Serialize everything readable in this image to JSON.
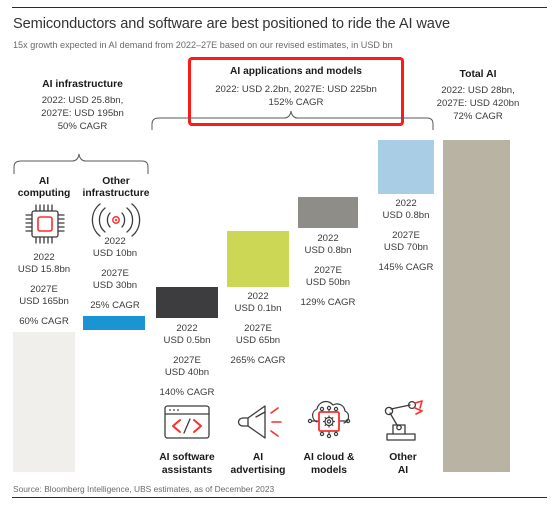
{
  "header": {
    "title": "Semiconductors and software are best positioned to ride the AI wave",
    "subtitle": "15x growth expected in AI demand from 2022–27E based on our revised estimates, in USD bn"
  },
  "footer": {
    "source": "Source: Bloomberg Intelligence, UBS estimates, as of December 2023"
  },
  "groups": {
    "ai_infrastructure": {
      "title": "AI infrastructure",
      "line1": "2022: USD 25.8bn,",
      "line2": "2027E: USD 195bn",
      "line3": "50% CAGR"
    },
    "ai_applications": {
      "title": "AI applications and models",
      "line1": "2022: USD 2.2bn, 2027E: USD 225bn",
      "line2": "152% CAGR",
      "highlight_color": "#ff1a1a"
    },
    "total_ai": {
      "title": "Total AI",
      "line1": "2022: USD 28bn,",
      "line2": "2027E: USD 420bn",
      "line3": "72% CAGR"
    }
  },
  "columns": [
    {
      "id": "ai-computing",
      "heading_line1": "AI",
      "heading_line2": "computing",
      "icon": "microchip-icon",
      "v2022_label": "2022",
      "v2022_value": "USD 15.8bn",
      "v2027_label": "2027E",
      "v2027_value": "USD 165bn",
      "cagr": "60% CAGR",
      "bar_color": "#f0efec"
    },
    {
      "id": "other-infrastructure",
      "heading_line1": "Other",
      "heading_line2": "infrastructure",
      "icon": "wireless-signal-icon",
      "v2022_label": "2022",
      "v2022_value": "USD 10bn",
      "v2027_label": "2027E",
      "v2027_value": "USD 30bn",
      "cagr": "25% CAGR",
      "bar_color": "#1b94d4"
    },
    {
      "id": "ai-software-assistants",
      "label_line1": "AI software",
      "label_line2": "assistants",
      "icon": "code-window-icon",
      "v2022_label": "2022",
      "v2022_value": "USD 0.5bn",
      "v2027_label": "2027E",
      "v2027_value": "USD 40bn",
      "cagr": "140% CAGR",
      "bar_color": "#3d3d40"
    },
    {
      "id": "ai-advertising",
      "label_line1": "AI",
      "label_line2": "advertising",
      "icon": "megaphone-icon",
      "v2022_label": "2022",
      "v2022_value": "USD 0.1bn",
      "v2027_label": "2027E",
      "v2027_value": "USD 65bn",
      "cagr": "265% CAGR",
      "bar_color": "#cbd755"
    },
    {
      "id": "ai-cloud-models",
      "label_line1": "AI cloud &",
      "label_line2": "models",
      "icon": "cloud-chip-icon",
      "v2022_label": "2022",
      "v2022_value": "USD 0.8bn",
      "v2027_label": "2027E",
      "v2027_value": "USD 50bn",
      "cagr": "129% CAGR",
      "bar_color": "#8e8d87"
    },
    {
      "id": "other-ai",
      "label_line1": "Other",
      "label_line2": "AI",
      "icon": "robot-arm-icon",
      "v2022_label": "2022",
      "v2022_value": "USD 0.8bn",
      "v2027_label": "2027E",
      "v2027_value": "USD 70bn",
      "cagr": "145% CAGR",
      "bar_color": "#a9cde5"
    },
    {
      "id": "total-ai",
      "bar_color": "#b8b3a2"
    }
  ],
  "chart_data": {
    "type": "bar",
    "title": "Semiconductors and software are best positioned to ride the AI wave",
    "subtitle": "15x growth expected in AI demand from 2022–27E based on our revised estimates, in USD bn",
    "ylabel": "USD bn",
    "xlabel": "",
    "grid": false,
    "legend": "none",
    "categories": [
      "AI computing",
      "Other infrastructure",
      "AI software assistants",
      "AI advertising",
      "AI cloud & models",
      "Other AI",
      "Total AI"
    ],
    "series": [
      {
        "name": "2022 (USD bn)",
        "values": [
          15.8,
          10,
          0.5,
          0.1,
          0.8,
          0.8,
          28
        ]
      },
      {
        "name": "2027E (USD bn)",
        "values": [
          165,
          30,
          40,
          65,
          50,
          70,
          420
        ]
      }
    ],
    "cagr": [
      "60%",
      "25%",
      "140%",
      "265%",
      "129%",
      "145%",
      "72%"
    ],
    "bar_values_plotted": [
      165,
      30,
      40,
      65,
      50,
      70,
      420
    ],
    "bar_colors": [
      "#f0efec",
      "#1b94d4",
      "#3d3d40",
      "#cbd755",
      "#8e8d87",
      "#a9cde5",
      "#b8b3a2"
    ],
    "ylim": [
      0,
      420
    ],
    "groupings": [
      {
        "name": "AI infrastructure",
        "members": [
          "AI computing",
          "Other infrastructure"
        ],
        "v2022": 25.8,
        "v2027": 195,
        "cagr": "50%"
      },
      {
        "name": "AI applications and models",
        "members": [
          "AI software assistants",
          "AI advertising",
          "AI cloud & models",
          "Other AI"
        ],
        "v2022": 2.2,
        "v2027": 225,
        "cagr": "152%"
      },
      {
        "name": "Total AI",
        "members": [
          "Total AI"
        ],
        "v2022": 28,
        "v2027": 420,
        "cagr": "72%"
      }
    ],
    "annotations": [
      "Source: Bloomberg Intelligence, UBS estimates, as of December 2023"
    ]
  }
}
